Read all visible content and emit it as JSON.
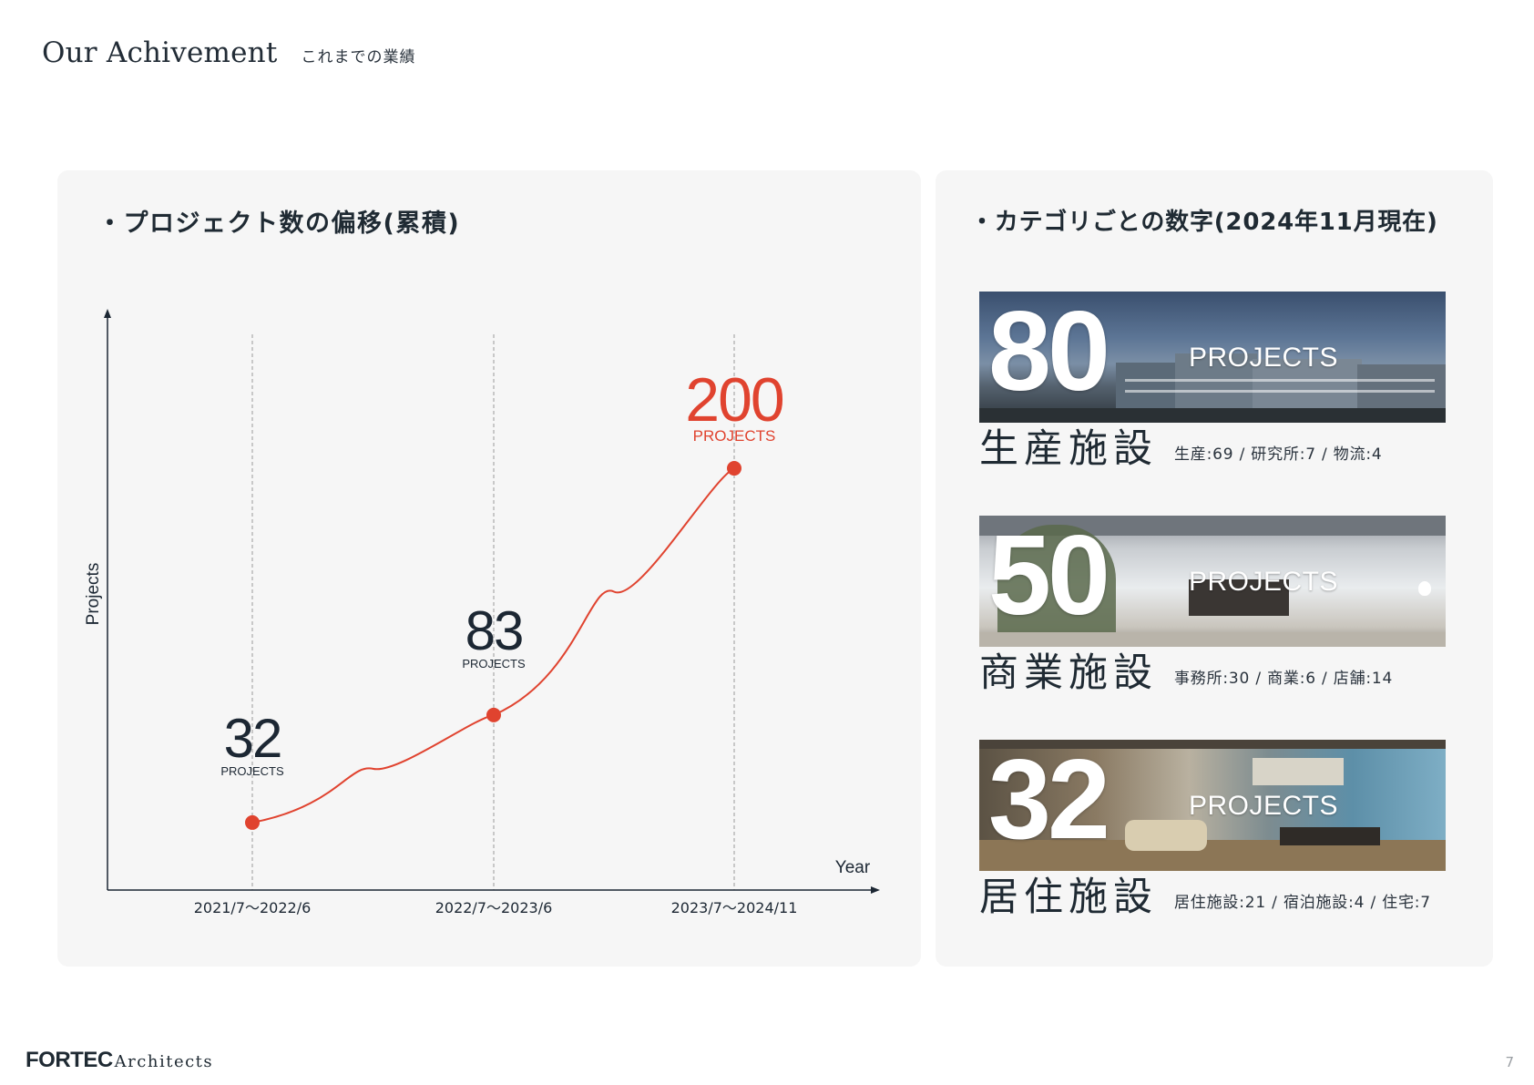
{
  "header": {
    "title_en": "Our Achivement",
    "title_ja": "これまでの業績"
  },
  "left_panel": {
    "heading": "・プロジェクト数の偏移(累積)"
  },
  "right_panel": {
    "heading": "・カテゴリごとの数字(2024年11月現在)"
  },
  "chart_data": {
    "type": "line",
    "title": "・プロジェクト数の偏移(累積)",
    "xlabel": "Year",
    "ylabel": "Projects",
    "categories": [
      "2021/7～2022/6",
      "2022/7～2023/6",
      "2023/7～2024/11"
    ],
    "values": [
      32,
      83,
      200
    ],
    "value_unit": "PROJECTS",
    "ylim": [
      0,
      270
    ],
    "grid": "vertical dashed lines at each category",
    "highlight_last": true,
    "colors": {
      "line": "#e0432f",
      "highlight_label": "#e0432f",
      "label": "#1c2733",
      "axis": "#1c2733",
      "grid": "#9a9a9a"
    }
  },
  "categories": [
    {
      "count": "80",
      "unit": "PROJECTS",
      "name": "生産施設",
      "detail": "生産:69 / 研究所:7 / 物流:4",
      "image": "factory-photo"
    },
    {
      "count": "50",
      "unit": "PROJECTS",
      "name": "商業施設",
      "detail": "事務所:30 / 商業:6 / 店舗:14",
      "image": "retail-store-photo"
    },
    {
      "count": "32",
      "unit": "PROJECTS",
      "name": "居住施設",
      "detail": "居住施設:21 / 宿泊施設:4 / 住宅:7",
      "image": "living-room-photo"
    }
  ],
  "footer": {
    "logo_main": "FORTEC",
    "logo_sub": "Architects",
    "page_number": "7"
  }
}
